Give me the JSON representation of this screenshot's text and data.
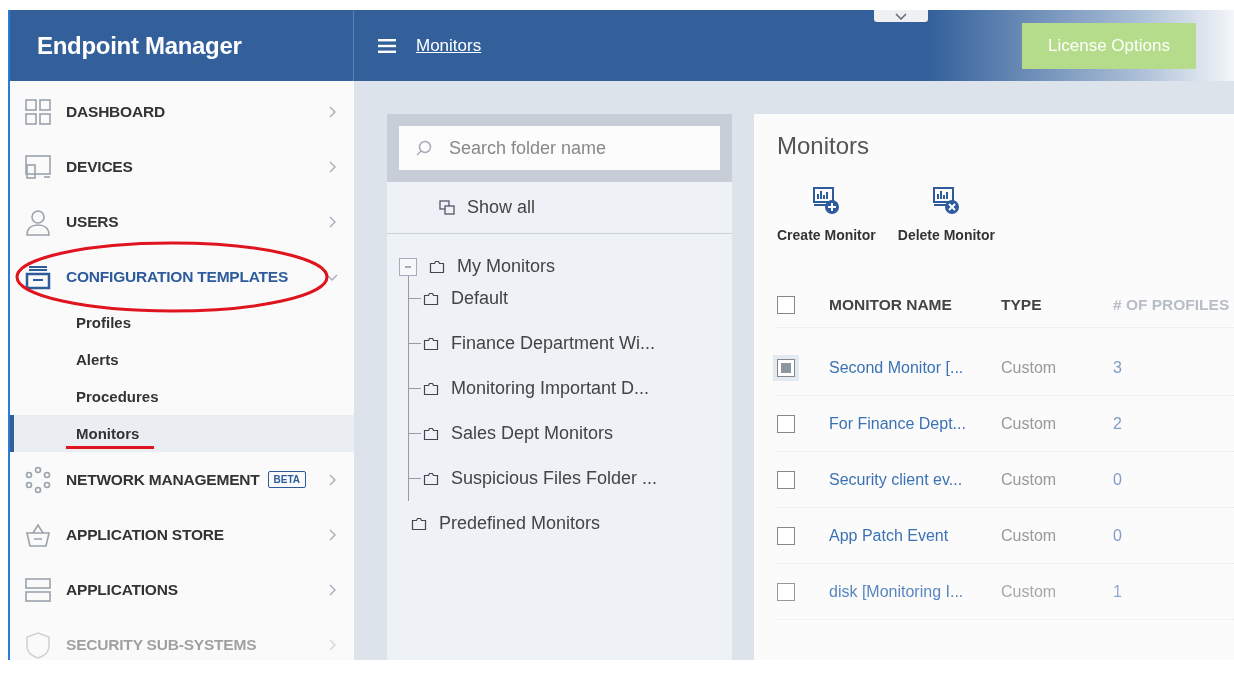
{
  "header": {
    "title": "Endpoint Manager",
    "breadcrumb": "Monitors",
    "license_button": "License Options"
  },
  "sidebar": {
    "items": [
      {
        "label": "DASHBOARD",
        "expanded": false,
        "circled": false
      },
      {
        "label": "DEVICES",
        "expanded": false,
        "circled": false
      },
      {
        "label": "USERS",
        "expanded": false,
        "circled": false
      },
      {
        "label": "CONFIGURATION TEMPLATES",
        "expanded": true,
        "circled": true,
        "children": [
          {
            "label": "Profiles",
            "selected": false,
            "underlined": false
          },
          {
            "label": "Alerts",
            "selected": false,
            "underlined": false
          },
          {
            "label": "Procedures",
            "selected": false,
            "underlined": false
          },
          {
            "label": "Monitors",
            "selected": true,
            "underlined": true
          }
        ]
      },
      {
        "label": "NETWORK MANAGEMENT",
        "badge": "BETA",
        "expanded": false,
        "circled": false
      },
      {
        "label": "APPLICATION STORE",
        "expanded": false,
        "circled": false
      },
      {
        "label": "APPLICATIONS",
        "expanded": false,
        "circled": false
      },
      {
        "label": "SECURITY SUB-SYSTEMS",
        "expanded": false,
        "circled": false,
        "disabled": true
      }
    ]
  },
  "folders": {
    "search": {
      "placeholder": "Search folder name"
    },
    "show_all": "Show all",
    "tree": [
      {
        "label": "My Monitors",
        "expanded": true,
        "children": [
          {
            "label": "Default"
          },
          {
            "label": "Finance Department Wi..."
          },
          {
            "label": "Monitoring Important D..."
          },
          {
            "label": "Sales Dept Monitors"
          },
          {
            "label": "Suspicious Files Folder ..."
          }
        ]
      },
      {
        "label": "Predefined Monitors"
      }
    ]
  },
  "panel": {
    "title": "Monitors",
    "actions": [
      {
        "label": "Create Monitor",
        "kind": "create"
      },
      {
        "label": "Delete Monitor",
        "kind": "delete"
      }
    ],
    "table": {
      "columns": [
        "MONITOR NAME",
        "TYPE",
        "# OF PROFILES"
      ],
      "all_checked": false,
      "rows": [
        {
          "name": "Second Monitor [...",
          "type": "Custom",
          "profiles": "3",
          "checked": true
        },
        {
          "name": "For Finance Dept...",
          "type": "Custom",
          "profiles": "2",
          "checked": false
        },
        {
          "name": "Security client ev...",
          "type": "Custom",
          "profiles": "0",
          "checked": false
        },
        {
          "name": "App Patch Event",
          "type": "Custom",
          "profiles": "0",
          "checked": false
        },
        {
          "name": "disk [Monitoring I...",
          "type": "Custom",
          "profiles": "1",
          "checked": false
        }
      ]
    }
  }
}
